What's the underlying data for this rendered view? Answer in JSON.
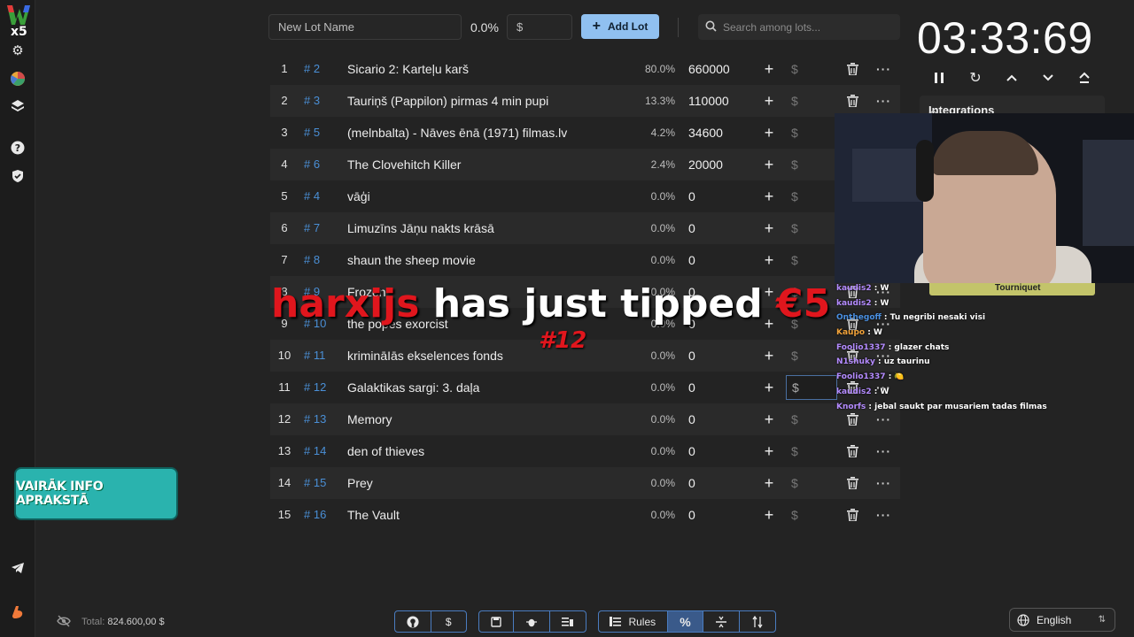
{
  "toolbar": {
    "lot_name_placeholder": "New Lot Name",
    "percent": "0.0%",
    "amount_placeholder": "$",
    "add_lot_label": "Add Lot",
    "search_placeholder": "Search among lots..."
  },
  "logo_text": "x5",
  "promo_text": "VAIRĀK INFO APRAKSTĀ",
  "lots": [
    {
      "index": "1",
      "id": "# 2",
      "name": "Sicario 2: Karteļu karš",
      "percent": "80.0%",
      "amount": "660000"
    },
    {
      "index": "2",
      "id": "# 3",
      "name": "Tauriņš (Pappilon) pirmas 4 min pupi",
      "percent": "13.3%",
      "amount": "110000"
    },
    {
      "index": "3",
      "id": "# 5",
      "name": "(melnbalta) - Nāves ēnā (1971) filmas.lv",
      "percent": "4.2%",
      "amount": "34600"
    },
    {
      "index": "4",
      "id": "# 6",
      "name": "The Clovehitch Killer",
      "percent": "2.4%",
      "amount": "20000"
    },
    {
      "index": "5",
      "id": "# 4",
      "name": "vāģi",
      "percent": "0.0%",
      "amount": "0"
    },
    {
      "index": "6",
      "id": "# 7",
      "name": "Limuzīns Jāņu nakts krāsā",
      "percent": "0.0%",
      "amount": "0"
    },
    {
      "index": "7",
      "id": "# 8",
      "name": "shaun the sheep movie",
      "percent": "0.0%",
      "amount": "0"
    },
    {
      "index": "8",
      "id": "# 9",
      "name": "Frozen",
      "percent": "0.0%",
      "amount": "0"
    },
    {
      "index": "9",
      "id": "# 10",
      "name": "the popes exorcist",
      "percent": "0.0%",
      "amount": "0"
    },
    {
      "index": "10",
      "id": "# 11",
      "name": "krimināIās ekselences fonds",
      "percent": "0.0%",
      "amount": "0"
    },
    {
      "index": "11",
      "id": "# 12",
      "name": "Galaktikas sargi: 3. daļa",
      "percent": "0.0%",
      "amount": "0"
    },
    {
      "index": "12",
      "id": "# 13",
      "name": "Memory",
      "percent": "0.0%",
      "amount": "0"
    },
    {
      "index": "13",
      "id": "# 14",
      "name": "den of thieves",
      "percent": "0.0%",
      "amount": "0"
    },
    {
      "index": "14",
      "id": "# 15",
      "name": "Prey",
      "percent": "0.0%",
      "amount": "0"
    },
    {
      "index": "15",
      "id": "# 16",
      "name": "The Vault",
      "percent": "0.0%",
      "amount": "0"
    }
  ],
  "dollar_symbol": "$",
  "timer": "03:33:69",
  "integrations_label": "Integrations",
  "tournament_label": "Tourniquet",
  "tip_alert": {
    "name": "harxijs",
    "text": " has just tipped ",
    "amount": "€5",
    "number": "#12"
  },
  "chat": [
    {
      "user": "kaudis2",
      "text": " : W",
      "color": "#b48bff"
    },
    {
      "user": "kaudis2",
      "text": " : W",
      "color": "#b48bff"
    },
    {
      "user": "Onthegoff",
      "text": " : Tu negribi nesaki visi",
      "color": "#4a90e2"
    },
    {
      "user": "Kaupo",
      "text": " : W",
      "color": "#f2a33a"
    },
    {
      "user": "Foolio1337",
      "text": " : glazer chats",
      "color": "#b48bff"
    },
    {
      "user": "N1shuky",
      "text": " : uz taurinu",
      "color": "#b48bff"
    },
    {
      "user": "Foolio1337",
      "text": " : 🍋",
      "color": "#b48bff"
    },
    {
      "user": "kaudis2",
      "text": " : W",
      "color": "#b48bff"
    },
    {
      "user": "Knorfs",
      "text": " : jebal saukt par musariem tadas filmas",
      "color": "#b48bff"
    }
  ],
  "footer": {
    "total_label": "Total:",
    "total_value": "824.600,00 $",
    "rules_label": "Rules",
    "language": "English"
  }
}
